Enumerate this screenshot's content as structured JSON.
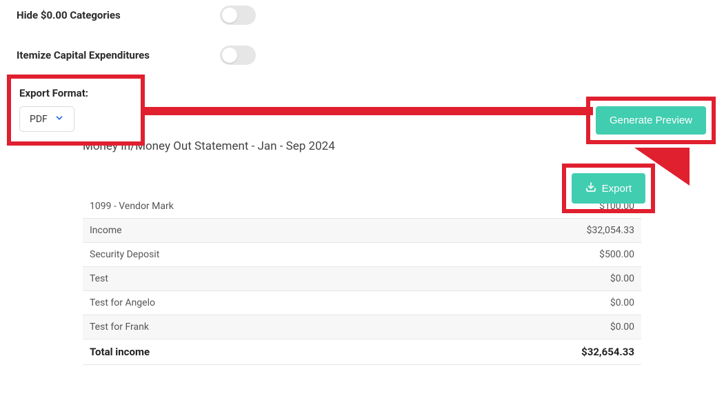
{
  "options": {
    "hide_zero_categories_label": "Hide $0.00 Categories",
    "itemize_capex_label": "Itemize Capital Expenditures"
  },
  "export": {
    "format_label": "Export Format:",
    "format_value": "PDF",
    "generate_preview_label": "Generate Preview",
    "export_button_label": "Export"
  },
  "report": {
    "title": "Money In/Money Out Statement - Jan - Sep 2024",
    "rows": [
      {
        "label": "1099 - Vendor Mark",
        "amount": "$100.00"
      },
      {
        "label": "Income",
        "amount": "$32,054.33"
      },
      {
        "label": "Security Deposit",
        "amount": "$500.00"
      },
      {
        "label": "Test",
        "amount": "$0.00"
      },
      {
        "label": "Test for Angelo",
        "amount": "$0.00"
      },
      {
        "label": "Test for Frank",
        "amount": "$0.00"
      }
    ],
    "total_label": "Total income",
    "total_amount": "$32,654.33"
  },
  "colors": {
    "accent_teal": "#41cdb0",
    "annotation_red": "#e01f2f",
    "chevron_blue": "#2b6be4"
  }
}
